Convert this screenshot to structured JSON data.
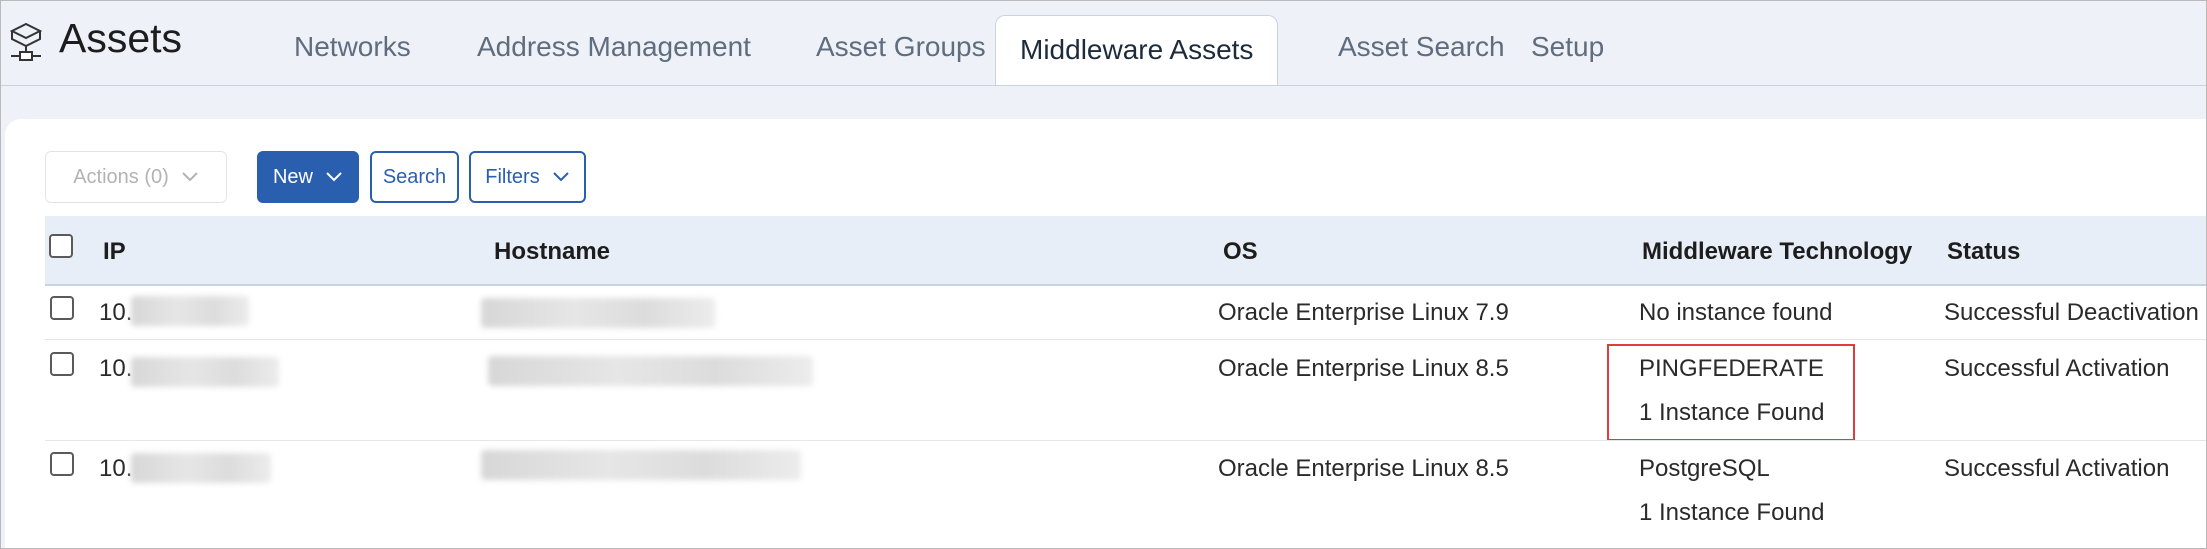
{
  "app": {
    "title": "Assets",
    "icon": "network-assets-icon"
  },
  "tabs": [
    {
      "label": "Networks",
      "active": false
    },
    {
      "label": "Address Management",
      "active": false
    },
    {
      "label": "Asset Groups",
      "active": false
    },
    {
      "label": "Middleware Assets",
      "active": true
    },
    {
      "label": "Asset Search",
      "active": false
    },
    {
      "label": "Setup",
      "active": false
    }
  ],
  "toolbar": {
    "actions_label": "Actions (0)",
    "new_label": "New",
    "search_label": "Search",
    "filters_label": "Filters"
  },
  "table": {
    "columns": [
      "IP",
      "Hostname",
      "OS",
      "Middleware Technology",
      "Status"
    ],
    "rows": [
      {
        "ip_prefix": "10.",
        "os": "Oracle Enterprise Linux 7.9",
        "tech_line1": "No instance found",
        "tech_line2": "",
        "status": "Successful Deactivation"
      },
      {
        "ip_prefix": "10.",
        "os": "Oracle Enterprise Linux 8.5",
        "tech_line1": "PINGFEDERATE",
        "tech_line2": "1 Instance Found",
        "status": "Successful Activation"
      },
      {
        "ip_prefix": "10.",
        "os": "Oracle Enterprise Linux 8.5",
        "tech_line1": "PostgreSQL",
        "tech_line2": "1 Instance Found",
        "status": "Successful Activation"
      }
    ]
  },
  "colors": {
    "accent": "#2a5fb0",
    "header_bg": "#eef2f8",
    "table_header_bg": "#e8eef7",
    "highlight": "#e23b3b"
  }
}
